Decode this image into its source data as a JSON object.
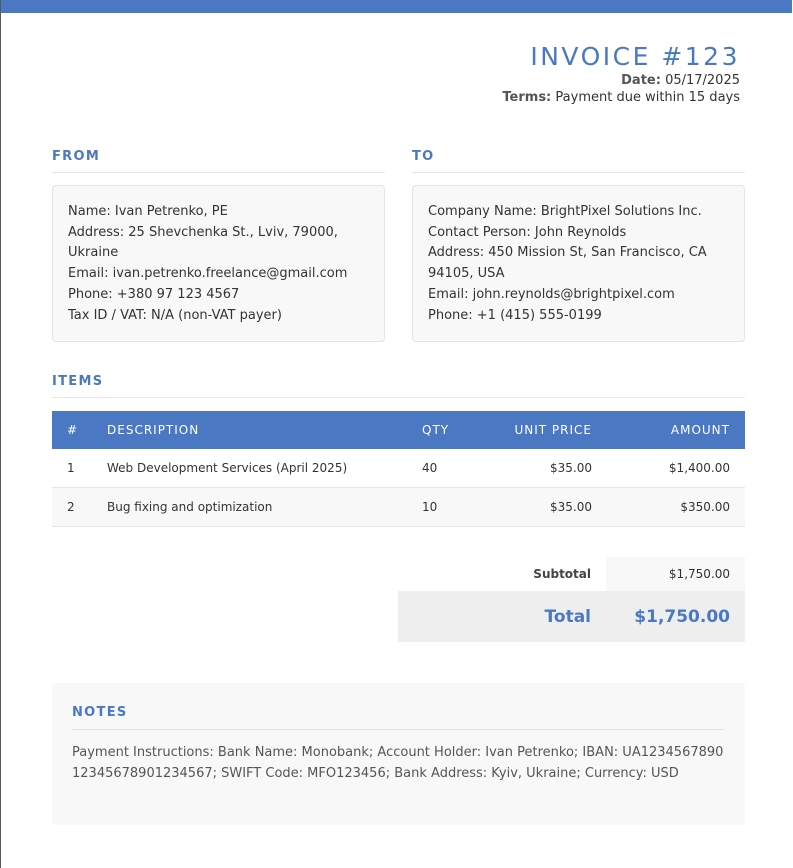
{
  "header": {
    "title": "INVOICE #123",
    "date_label": "Date:",
    "date_value": "05/17/2025",
    "terms_label": "Terms:",
    "terms_value": "Payment due within 15 days"
  },
  "from": {
    "title": "FROM",
    "lines": [
      "Name: Ivan Petrenko, PE",
      "Address: 25 Shevchenka St., Lviv, 79000, Ukraine",
      "Email: ivan.petrenko.freelance@gmail.com",
      "Phone: +380 97 123 4567",
      "Tax ID / VAT: N/A (non-VAT payer)"
    ]
  },
  "to": {
    "title": "TO",
    "lines": [
      "Company Name: BrightPixel Solutions Inc.",
      "Contact Person: John Reynolds",
      "Address: 450 Mission St, San Francisco, CA 94105, USA",
      "Email: john.reynolds@brightpixel.com",
      "Phone: +1 (415) 555-0199"
    ]
  },
  "items": {
    "title": "ITEMS",
    "columns": [
      "#",
      "DESCRIPTION",
      "QTY",
      "UNIT PRICE",
      "AMOUNT"
    ],
    "rows": [
      {
        "num": "1",
        "description": "Web Development Services (April 2025)",
        "qty": "40",
        "unit_price": "$35.00",
        "amount": "$1,400.00"
      },
      {
        "num": "2",
        "description": "Bug fixing and optimization",
        "qty": "10",
        "unit_price": "$35.00",
        "amount": "$350.00"
      }
    ]
  },
  "totals": {
    "subtotal_label": "Subtotal",
    "subtotal_value": "$1,750.00",
    "total_label": "Total",
    "total_value": "$1,750.00"
  },
  "notes": {
    "title": "NOTES",
    "body": "Payment Instructions: Bank Name: Monobank; Account Holder: Ivan Petrenko; IBAN: UA123456789012345678901234567; SWIFT Code: MFO123456; Bank Address: Kyiv, Ukraine; Currency: USD"
  },
  "colors": {
    "accent": "#4a78c2",
    "panel": "#f8f8f8",
    "total_bg": "#eeeeee"
  }
}
